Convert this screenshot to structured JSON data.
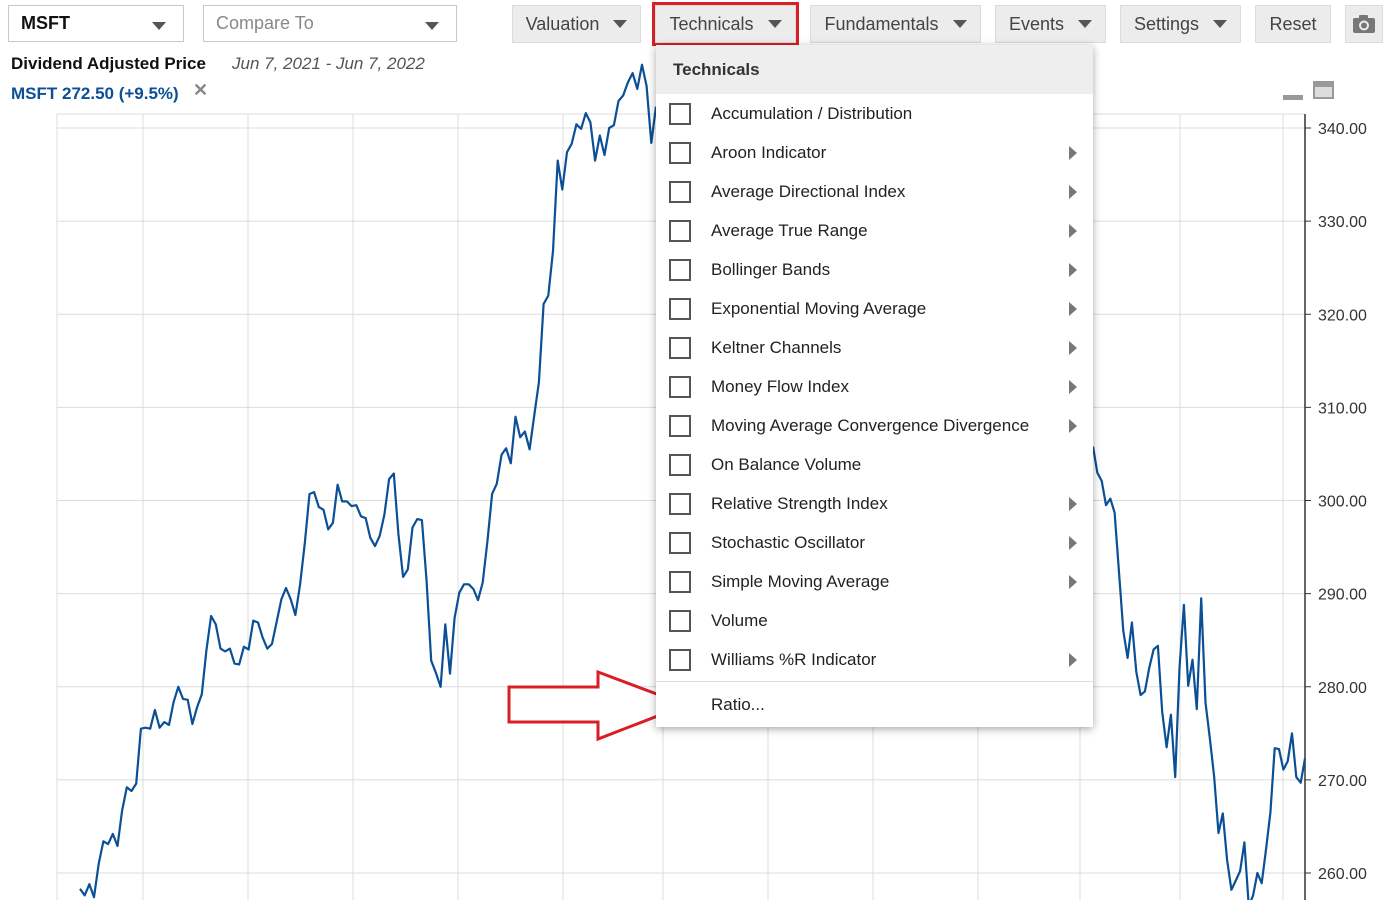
{
  "toolbar": {
    "symbol_value": "MSFT",
    "compare_placeholder": "Compare To",
    "valuation": "Valuation",
    "technicals": "Technicals",
    "fundamentals": "Fundamentals",
    "events": "Events",
    "settings": "Settings",
    "reset": "Reset",
    "camera_icon": "camera-icon"
  },
  "header": {
    "title": "Dividend Adjusted Price",
    "date_range": "Jun 7, 2021 - Jun 7, 2022",
    "quote": "MSFT 272.50 (+9.5%)",
    "remove_symbol": "✕"
  },
  "menu": {
    "heading": "Technicals",
    "items": [
      {
        "label": "Accumulation / Distribution",
        "submenu": false
      },
      {
        "label": "Aroon Indicator",
        "submenu": true
      },
      {
        "label": "Average Directional Index",
        "submenu": true
      },
      {
        "label": "Average True Range",
        "submenu": true
      },
      {
        "label": "Bollinger Bands",
        "submenu": true
      },
      {
        "label": "Exponential Moving Average",
        "submenu": true
      },
      {
        "label": "Keltner Channels",
        "submenu": true
      },
      {
        "label": "Money Flow Index",
        "submenu": true
      },
      {
        "label": "Moving Average Convergence Divergence",
        "submenu": true
      },
      {
        "label": "On Balance Volume",
        "submenu": false
      },
      {
        "label": "Relative Strength Index",
        "submenu": true
      },
      {
        "label": "Stochastic Oscillator",
        "submenu": true
      },
      {
        "label": "Simple Moving Average",
        "submenu": true
      },
      {
        "label": "Volume",
        "submenu": false
      },
      {
        "label": "Williams %R Indicator",
        "submenu": true
      }
    ],
    "ratio": "Ratio..."
  },
  "colors": {
    "line": "#0b4f96",
    "highlight": "#d91f26",
    "grid": "#dcdcdc"
  },
  "chart_data": {
    "type": "line",
    "title": "Dividend Adjusted Price",
    "series": [
      {
        "name": "MSFT",
        "y": [
          258.3,
          257.6,
          258.8,
          257.4,
          261.0,
          263.4,
          263.1,
          264.2,
          262.9,
          266.7,
          269.2,
          268.8,
          269.6,
          275.5,
          275.6,
          275.5,
          277.5,
          275.6,
          276.2,
          275.9,
          278.4,
          280.0,
          278.7,
          278.6,
          276.0,
          277.8,
          279.2,
          283.9,
          287.6,
          286.7,
          284.1,
          283.8,
          284.1,
          282.5,
          282.4,
          284.3,
          284.0,
          287.1,
          286.9,
          285.3,
          284.1,
          284.6,
          287.0,
          289.4,
          290.6,
          289.4,
          287.7,
          291.0,
          295.4,
          300.7,
          300.9,
          299.3,
          299.0,
          296.9,
          297.6,
          301.7,
          299.9,
          299.9,
          299.4,
          299.5,
          298.3,
          298.1,
          296.0,
          295.1,
          296.2,
          298.5,
          302.3,
          302.9,
          296.4,
          291.8,
          292.6,
          297.1,
          298.0,
          297.9,
          291.5,
          282.8,
          281.5,
          280.0,
          286.7,
          281.4,
          287.4,
          290.1,
          291.0,
          291.0,
          290.5,
          289.3,
          291.2,
          295.6,
          300.7,
          301.8,
          304.9,
          305.6,
          304.0,
          309.0,
          306.8,
          307.4,
          305.5,
          309.1,
          312.7,
          321.1,
          322.0,
          326.8,
          336.5,
          333.4,
          337.4,
          338.3,
          340.4,
          339.9,
          341.6,
          340.6,
          336.5,
          339.2,
          337.1,
          340.0,
          340.3,
          342.9,
          343.5,
          344.9,
          345.9,
          344.2,
          346.8,
          344.5,
          338.4,
          342.3
        ]
      }
    ],
    "ylim": [
      258,
      342
    ],
    "yticks": [
      "340.00",
      "330.00",
      "320.00",
      "310.00",
      "300.00",
      "290.00",
      "280.00",
      "270.00",
      "260.00"
    ],
    "tail": [
      305.8,
      303.0,
      302.1,
      299.5,
      300.2,
      298.7,
      292.3,
      286.0,
      283.1,
      286.9,
      281.6,
      279.1,
      279.5,
      282.0,
      284.0,
      284.4,
      277.3,
      273.5,
      277.0,
      270.3,
      282.0,
      288.8,
      280.1,
      282.9,
      277.6,
      289.5,
      278.3,
      274.5,
      270.4,
      264.3,
      266.4,
      261.4,
      258.2,
      259.2,
      260.2,
      263.3,
      256.4,
      257.6,
      260.0,
      258.9,
      262.6,
      266.5,
      273.4,
      273.3,
      271.1,
      272.0,
      275.0,
      270.3,
      269.7,
      272.3
    ]
  }
}
